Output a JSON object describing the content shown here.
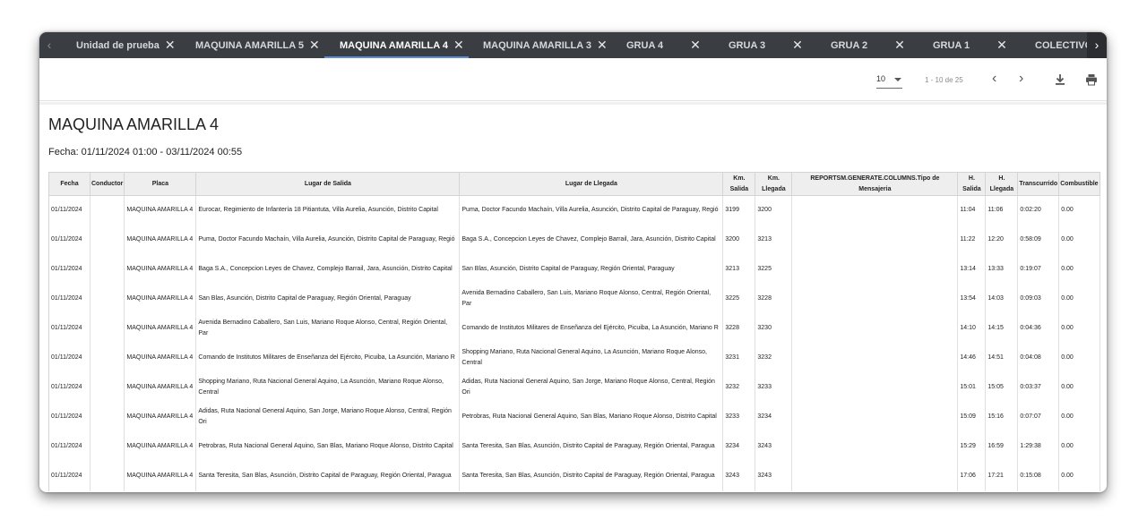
{
  "tabs": [
    {
      "label": "Unidad de prueba"
    },
    {
      "label": "MAQUINA AMARILLA 5"
    },
    {
      "label": "MAQUINA AMARILLA 4"
    },
    {
      "label": "MAQUINA AMARILLA 3"
    },
    {
      "label": "GRUA 4"
    },
    {
      "label": "GRUA 3"
    },
    {
      "label": "GRUA 2"
    },
    {
      "label": "GRUA 1"
    },
    {
      "label": "COLECTIVO"
    }
  ],
  "active_tab": "MAQUINA AMARILLA 4",
  "toolbar": {
    "page_size": "10",
    "range": "1 - 10 de 25"
  },
  "report": {
    "title": "MAQUINA AMARILLA 4",
    "date": "Fecha: 01/11/2024 01:00 - 03/11/2024 00:55"
  },
  "table": {
    "columns": [
      "Fecha",
      "Conductor",
      "Placa",
      "Lugar de Salida",
      "Lugar de Llegada",
      "Km. Salida",
      "Km. Llegada",
      "REPORTSM.GENERATE.COLUMNS.Tipo de Mensajeria",
      "H. Salida",
      "H. Llegada",
      "Transcurrido",
      "Combustible"
    ],
    "rows": [
      [
        "01/11/2024",
        "",
        "MAQUINA AMARILLA 4",
        "Eurocar, Regimiento de Infantería 18 Pitiantuta, Villa Aurelia, Asunción, Distrito Capital",
        "Puma, Doctor Facundo Machaín, Villa Aurelia, Asunción, Distrito Capital de Paraguay, Regió",
        "3199",
        "3200",
        "",
        "11:04",
        "11:06",
        "0:02:20",
        "0.00"
      ],
      [
        "01/11/2024",
        "",
        "MAQUINA AMARILLA 4",
        "Puma, Doctor Facundo Machaín, Villa Aurelia, Asunción, Distrito Capital de Paraguay, Regió",
        "Baga S.A., Concepcion Leyes de Chavez, Complejo Barrail, Jara, Asunción, Distrito Capital",
        "3200",
        "3213",
        "",
        "11:22",
        "12:20",
        "0:58:09",
        "0.00"
      ],
      [
        "01/11/2024",
        "",
        "MAQUINA AMARILLA 4",
        "Baga S.A., Concepcion Leyes de Chavez, Complejo Barrail, Jara, Asunción, Distrito Capital",
        "San Blas, Asunción, Distrito Capital de Paraguay, Región Oriental, Paraguay",
        "3213",
        "3225",
        "",
        "13:14",
        "13:33",
        "0:19:07",
        "0.00"
      ],
      [
        "01/11/2024",
        "",
        "MAQUINA AMARILLA 4",
        "San Blas, Asunción, Distrito Capital de Paraguay, Región Oriental, Paraguay",
        "Avenida Bernadino Caballero, San Luis, Mariano Roque Alonso, Central, Región Oriental, Par",
        "3225",
        "3228",
        "",
        "13:54",
        "14:03",
        "0:09:03",
        "0.00"
      ],
      [
        "01/11/2024",
        "",
        "MAQUINA AMARILLA 4",
        "Avenida Bernadino Caballero, San Luis, Mariano Roque Alonso, Central, Región Oriental, Par",
        "Comando de Institutos Militares de Enseñanza del Ejército, Picuiba, La Asunción, Mariano R",
        "3228",
        "3230",
        "",
        "14:10",
        "14:15",
        "0:04:36",
        "0.00"
      ],
      [
        "01/11/2024",
        "",
        "MAQUINA AMARILLA 4",
        "Comando de Institutos Militares de Enseñanza del Ejército, Picuiba, La Asunción, Mariano R",
        "Shopping Mariano, Ruta Nacional General Aquino, La Asunción, Mariano Roque Alonso, Central",
        "3231",
        "3232",
        "",
        "14:46",
        "14:51",
        "0:04:08",
        "0.00"
      ],
      [
        "01/11/2024",
        "",
        "MAQUINA AMARILLA 4",
        "Shopping Mariano, Ruta Nacional General Aquino, La Asunción, Mariano Roque Alonso, Central",
        "Adidas, Ruta Nacional General Aquino, San Jorge, Mariano Roque Alonso, Central, Región Ori",
        "3232",
        "3233",
        "",
        "15:01",
        "15:05",
        "0:03:37",
        "0.00"
      ],
      [
        "01/11/2024",
        "",
        "MAQUINA AMARILLA 4",
        "Adidas, Ruta Nacional General Aquino, San Jorge, Mariano Roque Alonso, Central, Región Ori",
        "Petrobras, Ruta Nacional General Aquino, San Blas, Mariano Roque Alonso, Distrito Capital",
        "3233",
        "3234",
        "",
        "15:09",
        "15:16",
        "0:07:07",
        "0.00"
      ],
      [
        "01/11/2024",
        "",
        "MAQUINA AMARILLA 4",
        "Petrobras, Ruta Nacional General Aquino, San Blas, Mariano Roque Alonso, Distrito Capital",
        "Santa Teresita, San Blas, Asunción, Distrito Capital de Paraguay, Región Oriental, Paragua",
        "3234",
        "3243",
        "",
        "15:29",
        "16:59",
        "1:29:38",
        "0.00"
      ],
      [
        "01/11/2024",
        "",
        "MAQUINA AMARILLA 4",
        "Santa Teresita, San Blas, Asunción, Distrito Capital de Paraguay, Región Oriental, Paragua",
        "Santa Teresita, San Blas, Asunción, Distrito Capital de Paraguay, Región Oriental, Paragua",
        "3243",
        "3243",
        "",
        "17:06",
        "17:21",
        "0:15:08",
        "0.00"
      ]
    ]
  },
  "icons": {
    "tab_close": "close-icon",
    "prev": "chevron-left-icon",
    "next": "chevron-right-icon",
    "download": "download-icon",
    "print": "print-icon"
  },
  "colors": {
    "tabbar": "#3a3d42",
    "active_underline": "#5a8ed8",
    "header_bg": "#eeeeee"
  }
}
